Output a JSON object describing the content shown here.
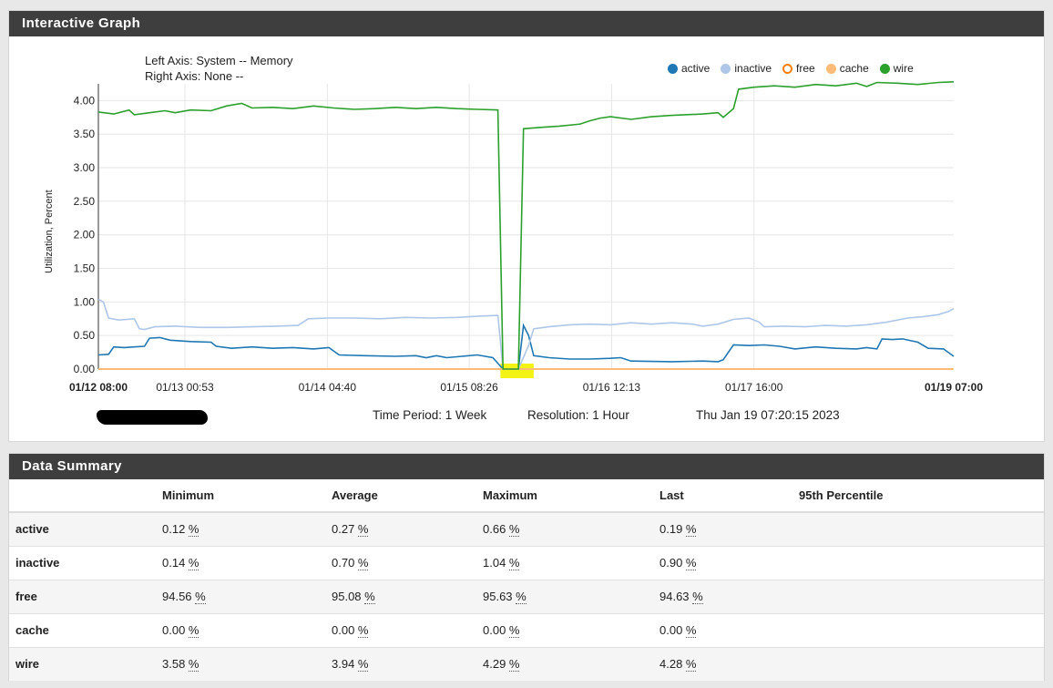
{
  "graph_panel": {
    "title": "Interactive Graph"
  },
  "graph": {
    "left_axis": "Left Axis: System -- Memory",
    "right_axis": "Right Axis: None --",
    "time_period": "Time Period: 1 Week",
    "resolution": "Resolution: 1 Hour",
    "timestamp": "Thu Jan 19 07:20:15 2023"
  },
  "chart_data": {
    "type": "line",
    "ylabel": "Utilization, Percent",
    "xlabel": "",
    "ylim": [
      0,
      4.25
    ],
    "yticks": [
      "0.00",
      "0.50",
      "1.00",
      "1.50",
      "2.00",
      "2.50",
      "3.00",
      "3.50",
      "4.00"
    ],
    "xlim_hours": [
      0,
      167
    ],
    "xticks": [
      {
        "label": "01/12 08:00",
        "bold": true,
        "h": 0
      },
      {
        "label": "01/13 00:53",
        "bold": false,
        "h": 16.9
      },
      {
        "label": "01/14 04:40",
        "bold": false,
        "h": 44.7
      },
      {
        "label": "01/15 08:26",
        "bold": false,
        "h": 72.4
      },
      {
        "label": "01/16 12:13",
        "bold": false,
        "h": 100.2
      },
      {
        "label": "01/17 16:00",
        "bold": false,
        "h": 128
      },
      {
        "label": "01/19 07:00",
        "bold": true,
        "h": 167
      }
    ],
    "grid": true,
    "legend_position": "top-right",
    "series": [
      {
        "name": "active",
        "color": "#1f77b4",
        "hollow": false,
        "points": [
          [
            0,
            0.21
          ],
          [
            2,
            0.22
          ],
          [
            3,
            0.33
          ],
          [
            5,
            0.32
          ],
          [
            7,
            0.33
          ],
          [
            9,
            0.34
          ],
          [
            10,
            0.46
          ],
          [
            12,
            0.47
          ],
          [
            14,
            0.43
          ],
          [
            18,
            0.41
          ],
          [
            22,
            0.4
          ],
          [
            23,
            0.34
          ],
          [
            26,
            0.31
          ],
          [
            30,
            0.33
          ],
          [
            34,
            0.31
          ],
          [
            38,
            0.32
          ],
          [
            42,
            0.3
          ],
          [
            45,
            0.32
          ],
          [
            47,
            0.21
          ],
          [
            52,
            0.2
          ],
          [
            58,
            0.19
          ],
          [
            62,
            0.2
          ],
          [
            64,
            0.17
          ],
          [
            66,
            0.2
          ],
          [
            68,
            0.17
          ],
          [
            71,
            0.19
          ],
          [
            74,
            0.21
          ],
          [
            77,
            0.17
          ],
          [
            79,
            0.0
          ],
          [
            82,
            0.0
          ],
          [
            83,
            0.65
          ],
          [
            84,
            0.5
          ],
          [
            85,
            0.2
          ],
          [
            88,
            0.17
          ],
          [
            92,
            0.15
          ],
          [
            96,
            0.15
          ],
          [
            100,
            0.16
          ],
          [
            102,
            0.17
          ],
          [
            104,
            0.12
          ],
          [
            112,
            0.11
          ],
          [
            118,
            0.12
          ],
          [
            121,
            0.11
          ],
          [
            122,
            0.14
          ],
          [
            124,
            0.36
          ],
          [
            127,
            0.35
          ],
          [
            130,
            0.36
          ],
          [
            133,
            0.34
          ],
          [
            136,
            0.3
          ],
          [
            140,
            0.33
          ],
          [
            144,
            0.31
          ],
          [
            148,
            0.3
          ],
          [
            150,
            0.32
          ],
          [
            152,
            0.3
          ],
          [
            153,
            0.45
          ],
          [
            155,
            0.44
          ],
          [
            157,
            0.45
          ],
          [
            160,
            0.4
          ],
          [
            162,
            0.31
          ],
          [
            165,
            0.3
          ],
          [
            167,
            0.19
          ]
        ]
      },
      {
        "name": "inactive",
        "color": "#aec7e8",
        "hollow": false,
        "points": [
          [
            0,
            1.04
          ],
          [
            1,
            1.0
          ],
          [
            2,
            0.76
          ],
          [
            4,
            0.73
          ],
          [
            7,
            0.75
          ],
          [
            8,
            0.6
          ],
          [
            9,
            0.59
          ],
          [
            11,
            0.63
          ],
          [
            15,
            0.64
          ],
          [
            20,
            0.62
          ],
          [
            25,
            0.62
          ],
          [
            30,
            0.63
          ],
          [
            35,
            0.64
          ],
          [
            39,
            0.65
          ],
          [
            41,
            0.75
          ],
          [
            45,
            0.76
          ],
          [
            50,
            0.76
          ],
          [
            55,
            0.75
          ],
          [
            60,
            0.77
          ],
          [
            65,
            0.76
          ],
          [
            70,
            0.77
          ],
          [
            75,
            0.79
          ],
          [
            78,
            0.8
          ],
          [
            79,
            0.0
          ],
          [
            82,
            0.0
          ],
          [
            84,
            0.35
          ],
          [
            85,
            0.6
          ],
          [
            88,
            0.63
          ],
          [
            92,
            0.66
          ],
          [
            96,
            0.67
          ],
          [
            100,
            0.66
          ],
          [
            104,
            0.69
          ],
          [
            108,
            0.67
          ],
          [
            112,
            0.69
          ],
          [
            116,
            0.67
          ],
          [
            118,
            0.64
          ],
          [
            121,
            0.67
          ],
          [
            124,
            0.74
          ],
          [
            127,
            0.76
          ],
          [
            129,
            0.7
          ],
          [
            130,
            0.63
          ],
          [
            134,
            0.64
          ],
          [
            138,
            0.63
          ],
          [
            142,
            0.65
          ],
          [
            146,
            0.64
          ],
          [
            150,
            0.66
          ],
          [
            154,
            0.7
          ],
          [
            158,
            0.76
          ],
          [
            161,
            0.78
          ],
          [
            164,
            0.81
          ],
          [
            166,
            0.86
          ],
          [
            167,
            0.9
          ]
        ]
      },
      {
        "name": "free",
        "color": "#ff7f0e",
        "hollow": true,
        "points": []
      },
      {
        "name": "cache",
        "color": "#ffbb78",
        "hollow": false,
        "points": [
          [
            0,
            0.0
          ],
          [
            167,
            0.0
          ]
        ]
      },
      {
        "name": "wire",
        "color": "#2ca02c",
        "hollow": false,
        "points": [
          [
            0,
            3.83
          ],
          [
            3,
            3.8
          ],
          [
            6,
            3.86
          ],
          [
            7,
            3.79
          ],
          [
            10,
            3.82
          ],
          [
            13,
            3.85
          ],
          [
            15,
            3.82
          ],
          [
            18,
            3.86
          ],
          [
            22,
            3.85
          ],
          [
            25,
            3.92
          ],
          [
            28,
            3.96
          ],
          [
            30,
            3.89
          ],
          [
            34,
            3.9
          ],
          [
            38,
            3.88
          ],
          [
            42,
            3.92
          ],
          [
            46,
            3.89
          ],
          [
            50,
            3.87
          ],
          [
            54,
            3.88
          ],
          [
            58,
            3.9
          ],
          [
            62,
            3.88
          ],
          [
            66,
            3.9
          ],
          [
            70,
            3.88
          ],
          [
            74,
            3.87
          ],
          [
            78,
            3.86
          ],
          [
            79,
            0.0
          ],
          [
            82,
            0.0
          ],
          [
            83,
            3.58
          ],
          [
            86,
            3.6
          ],
          [
            90,
            3.62
          ],
          [
            94,
            3.65
          ],
          [
            96,
            3.7
          ],
          [
            98,
            3.74
          ],
          [
            100,
            3.76
          ],
          [
            104,
            3.72
          ],
          [
            108,
            3.76
          ],
          [
            112,
            3.78
          ],
          [
            118,
            3.8
          ],
          [
            121,
            3.82
          ],
          [
            122,
            3.75
          ],
          [
            124,
            3.88
          ],
          [
            125,
            4.17
          ],
          [
            128,
            4.2
          ],
          [
            132,
            4.22
          ],
          [
            136,
            4.2
          ],
          [
            140,
            4.24
          ],
          [
            144,
            4.22
          ],
          [
            148,
            4.26
          ],
          [
            150,
            4.21
          ],
          [
            152,
            4.27
          ],
          [
            156,
            4.26
          ],
          [
            160,
            4.24
          ],
          [
            164,
            4.27
          ],
          [
            167,
            4.28
          ]
        ]
      }
    ]
  },
  "summary_panel": {
    "title": "Data Summary"
  },
  "summary": {
    "headers": [
      "",
      "Minimum",
      "Average",
      "Maximum",
      "Last",
      "95th Percentile"
    ],
    "rows": [
      {
        "name": "active",
        "min": "0.12",
        "avg": "0.27",
        "max": "0.66",
        "last": "0.19",
        "p95": ""
      },
      {
        "name": "inactive",
        "min": "0.14",
        "avg": "0.70",
        "max": "1.04",
        "last": "0.90",
        "p95": ""
      },
      {
        "name": "free",
        "min": "94.56",
        "avg": "95.08",
        "max": "95.63",
        "last": "94.63",
        "p95": ""
      },
      {
        "name": "cache",
        "min": "0.00",
        "avg": "0.00",
        "max": "0.00",
        "last": "0.00",
        "p95": ""
      },
      {
        "name": "wire",
        "min": "3.58",
        "avg": "3.94",
        "max": "4.29",
        "last": "4.28",
        "p95": ""
      }
    ],
    "unit": "%"
  }
}
